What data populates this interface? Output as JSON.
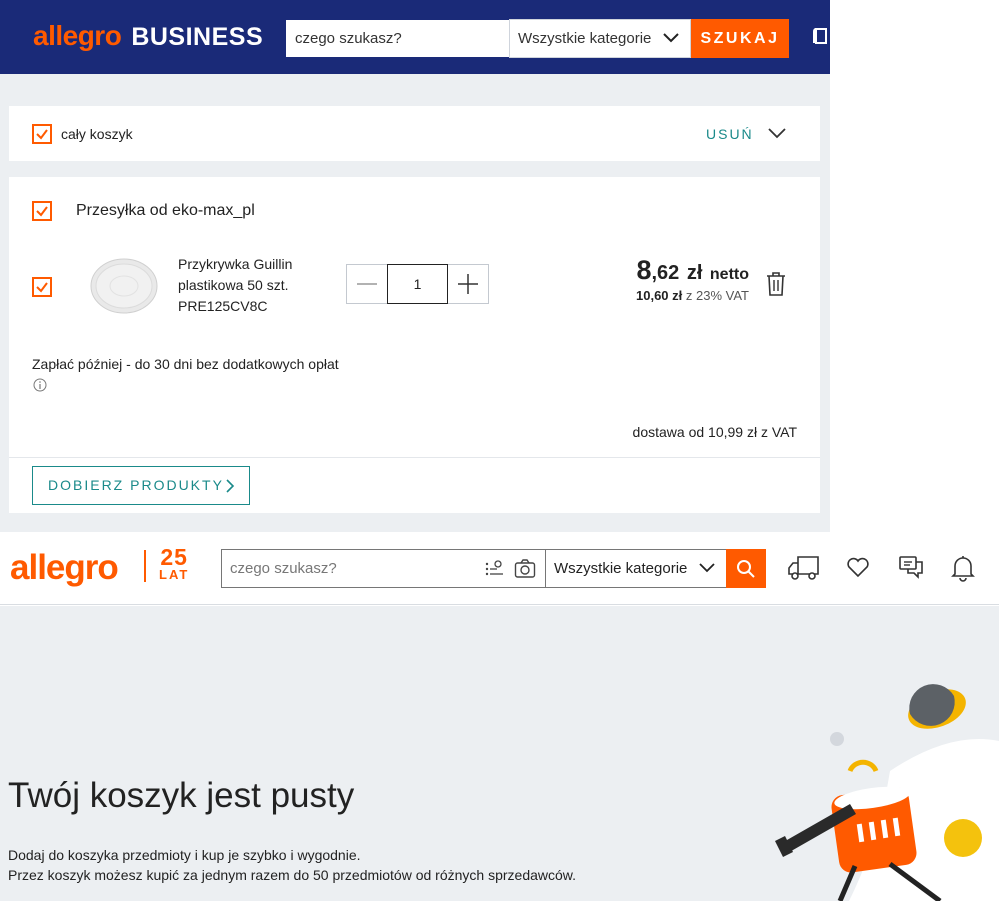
{
  "business": {
    "logo_brand": "allegro",
    "logo_suffix": "BUSINESS",
    "search_placeholder": "czego szukasz?",
    "category": "Wszystkie kategorie",
    "search_button": "SZUKAJ",
    "cart": {
      "select_all_label": "cały koszyk",
      "remove_label": "USUŃ",
      "shipment_title": "Przesyłka od eko-max_pl",
      "item": {
        "name_line1": "Przykrywka Guillin",
        "name_line2": "plastikowa 50 szt.",
        "name_line3": "PRE125CV8C",
        "quantity": "1",
        "price_int": "8",
        "price_dec": ",62",
        "currency": "zł",
        "net_label": "netto",
        "gross_price": "10,60 zł",
        "vat_label": "z 23% VAT"
      },
      "pay_later": "Zapłać później - do 30 dni bez dodatkowych opłat",
      "delivery": "dostawa od 10,99 zł z VAT",
      "match_products": "DOBIERZ PRODUKTY"
    }
  },
  "consumer_header": {
    "logo_brand": "allegro",
    "anniversary_number": "25",
    "anniversary_word": "LAT",
    "search_placeholder": "czego szukasz?",
    "category": "Wszystkie kategorie"
  },
  "empty_cart": {
    "title": "Twój koszyk jest pusty",
    "line1": "Dodaj do koszyka przedmioty i kup je szybko i wygodnie.",
    "line2": "Przez koszyk możesz kupić za jednym razem do 50 przedmiotów od różnych sprzedawców."
  },
  "colors": {
    "brand_orange": "#ff5a00",
    "business_navy": "#1a2a78",
    "teal": "#1a8a8a"
  }
}
